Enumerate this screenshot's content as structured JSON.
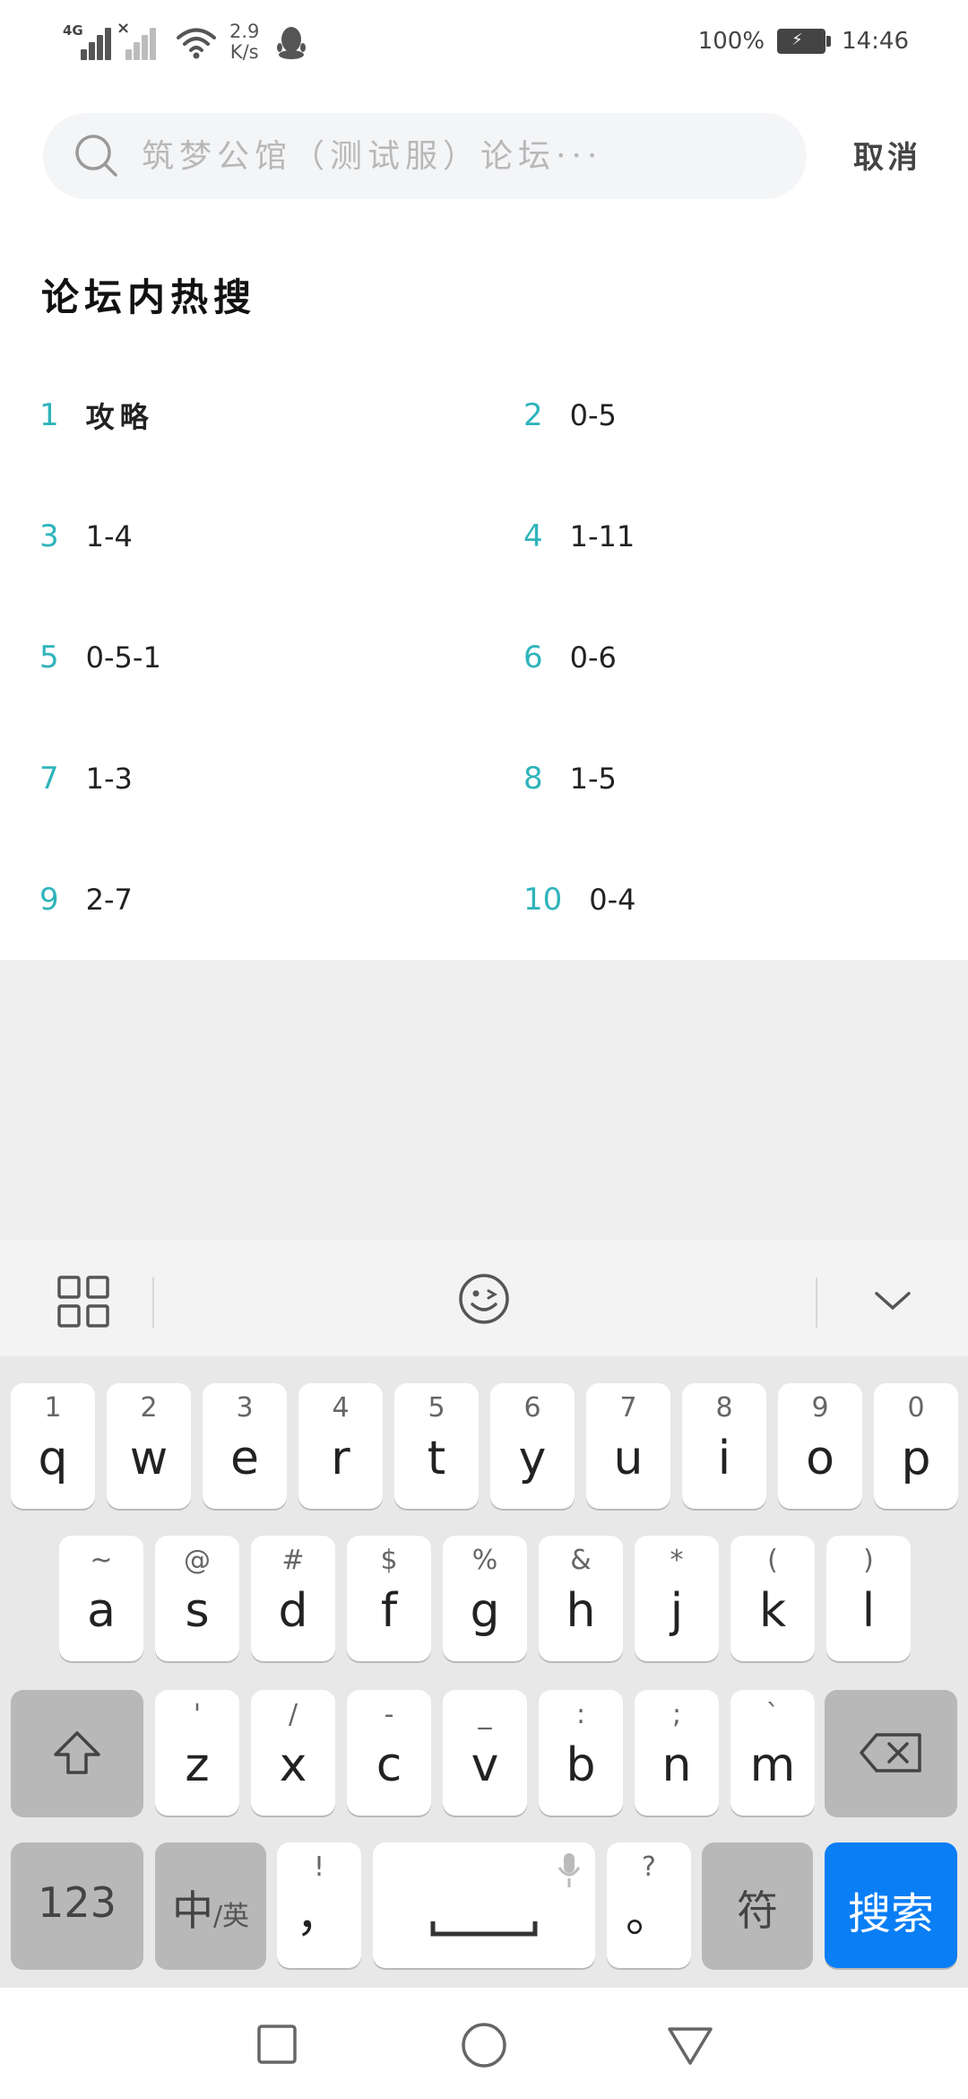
{
  "status_bar": {
    "network_tag": "4G",
    "net_speed_value": "2.9",
    "net_speed_unit": "K/s",
    "battery": "100%",
    "time": "14:46"
  },
  "search": {
    "placeholder": "筑梦公馆（测试服）论坛···",
    "cancel_label": "取消"
  },
  "hot": {
    "title": "论坛内热搜",
    "items": [
      {
        "rank": "1",
        "term": "攻略"
      },
      {
        "rank": "2",
        "term": "0-5"
      },
      {
        "rank": "3",
        "term": "1-4"
      },
      {
        "rank": "4",
        "term": "1-11"
      },
      {
        "rank": "5",
        "term": "0-5-1"
      },
      {
        "rank": "6",
        "term": "0-6"
      },
      {
        "rank": "7",
        "term": "1-3"
      },
      {
        "rank": "8",
        "term": "1-5"
      },
      {
        "rank": "9",
        "term": "2-7"
      },
      {
        "rank": "10",
        "term": "0-4"
      }
    ]
  },
  "keyboard": {
    "row1": [
      {
        "sec": "1",
        "main": "q"
      },
      {
        "sec": "2",
        "main": "w"
      },
      {
        "sec": "3",
        "main": "e"
      },
      {
        "sec": "4",
        "main": "r"
      },
      {
        "sec": "5",
        "main": "t"
      },
      {
        "sec": "6",
        "main": "y"
      },
      {
        "sec": "7",
        "main": "u"
      },
      {
        "sec": "8",
        "main": "i"
      },
      {
        "sec": "9",
        "main": "o"
      },
      {
        "sec": "0",
        "main": "p"
      }
    ],
    "row2": [
      {
        "sec": "~",
        "main": "a"
      },
      {
        "sec": "@",
        "main": "s"
      },
      {
        "sec": "#",
        "main": "d"
      },
      {
        "sec": "$",
        "main": "f"
      },
      {
        "sec": "%",
        "main": "g"
      },
      {
        "sec": "&",
        "main": "h"
      },
      {
        "sec": "*",
        "main": "j"
      },
      {
        "sec": "(",
        "main": "k"
      },
      {
        "sec": ")",
        "main": "l"
      }
    ],
    "row3": [
      {
        "sec": "'",
        "main": "z"
      },
      {
        "sec": "/",
        "main": "x"
      },
      {
        "sec": "-",
        "main": "c"
      },
      {
        "sec": "_",
        "main": "v"
      },
      {
        "sec": ":",
        "main": "b"
      },
      {
        "sec": ";",
        "main": "n"
      },
      {
        "sec": "`",
        "main": "m"
      }
    ],
    "num_label": "123",
    "cn_label": "中",
    "en_label": "/英",
    "comma_sec": "!",
    "comma_main": "，",
    "period_sec": "?",
    "period_main": "。",
    "sym_label": "符",
    "search_label": "搜索"
  },
  "colors": {
    "accent": "#2fb4bb",
    "search_key": "#0a7ef5"
  }
}
